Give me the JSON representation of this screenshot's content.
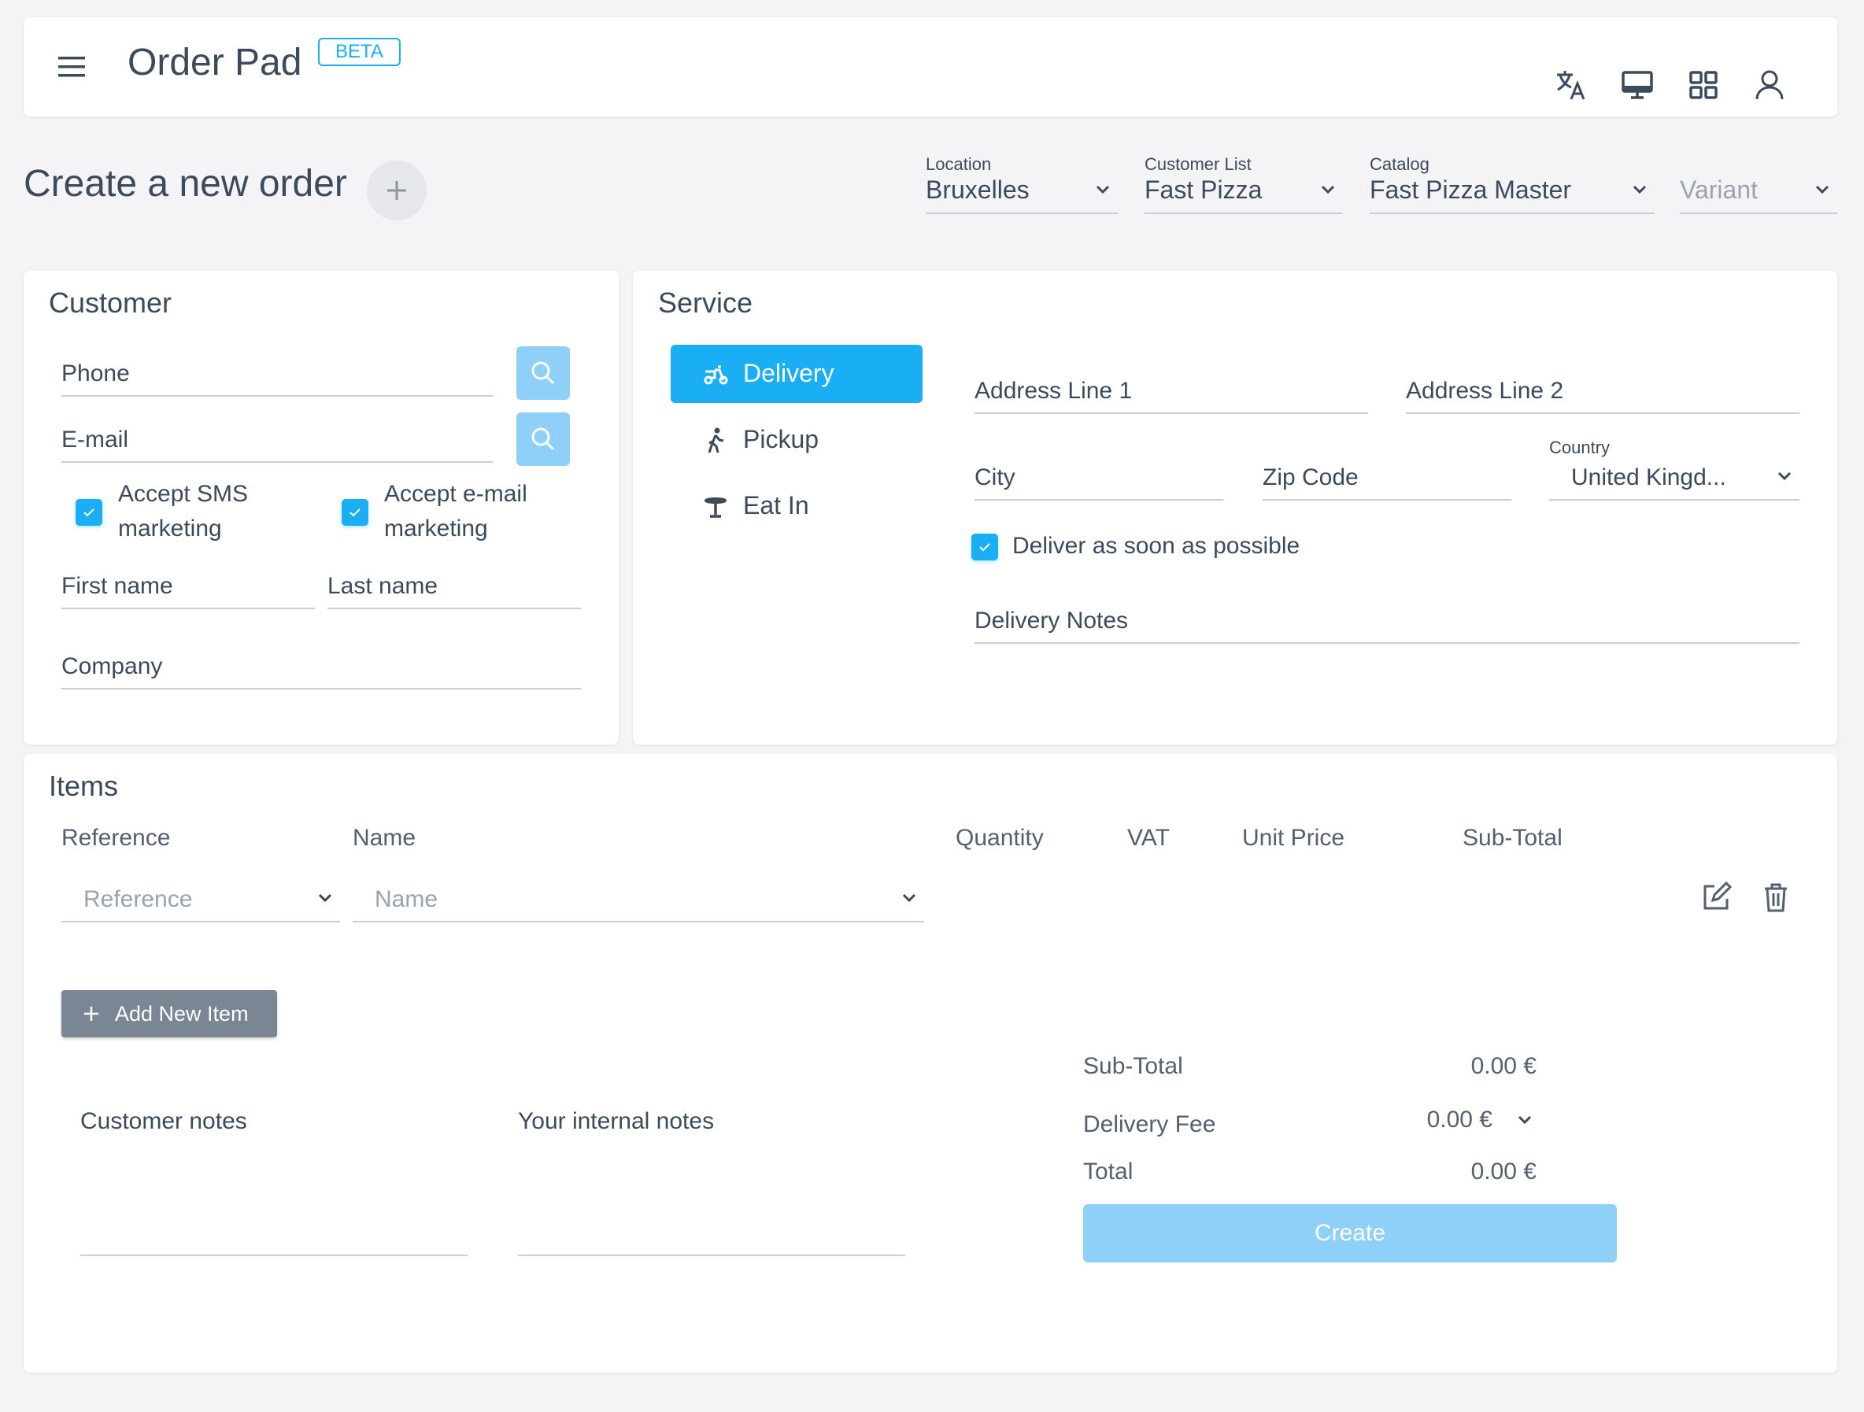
{
  "header": {
    "app_title": "Order Pad",
    "badge": "BETA",
    "icons": [
      "menu-icon",
      "translate-icon",
      "monitor-icon",
      "grid-icon",
      "user-icon"
    ]
  },
  "page": {
    "title": "Create a new order",
    "selectors": {
      "location": {
        "label": "Location",
        "value": "Bruxelles"
      },
      "customer_list": {
        "label": "Customer List",
        "value": "Fast Pizza"
      },
      "catalog": {
        "label": "Catalog",
        "value": "Fast Pizza Master"
      },
      "variant": {
        "placeholder": "Variant"
      }
    }
  },
  "customer": {
    "title": "Customer",
    "phone": "Phone",
    "email": "E-mail",
    "sms_line1": "Accept SMS",
    "sms_line2": "marketing",
    "sms_checked": true,
    "email_mkt_line1": "Accept e-mail",
    "email_mkt_line2": "marketing",
    "email_mkt_checked": true,
    "first_name": "First name",
    "last_name": "Last name",
    "company": "Company"
  },
  "service": {
    "title": "Service",
    "options": [
      {
        "label": "Delivery",
        "active": true,
        "icon": "scooter-icon"
      },
      {
        "label": "Pickup",
        "active": false,
        "icon": "walk-icon"
      },
      {
        "label": "Eat In",
        "active": false,
        "icon": "table-icon"
      }
    ],
    "address1": "Address Line 1",
    "address2": "Address Line 2",
    "city": "City",
    "zip": "Zip Code",
    "country_label": "Country",
    "country_value": "United Kingd...",
    "asap": "Deliver as soon as possible",
    "asap_checked": true,
    "notes": "Delivery Notes"
  },
  "items": {
    "title": "Items",
    "columns": [
      "Reference",
      "Name",
      "Quantity",
      "VAT",
      "Unit Price",
      "Sub-Total"
    ],
    "row": {
      "reference_placeholder": "Reference",
      "name_placeholder": "Name"
    },
    "add_button": "Add New Item",
    "customer_notes": "Customer notes",
    "internal_notes": "Your internal notes"
  },
  "totals": {
    "subtotal_label": "Sub-Total",
    "subtotal_value": "0.00 €",
    "fee_label": "Delivery Fee",
    "fee_value": "0.00 €",
    "total_label": "Total",
    "total_value": "0.00 €",
    "create_button": "Create"
  },
  "colors": {
    "accent": "#1aaef5",
    "accent_light": "#8fd0f8",
    "add_button": "#7b8694",
    "background": "#f4f4f7"
  }
}
